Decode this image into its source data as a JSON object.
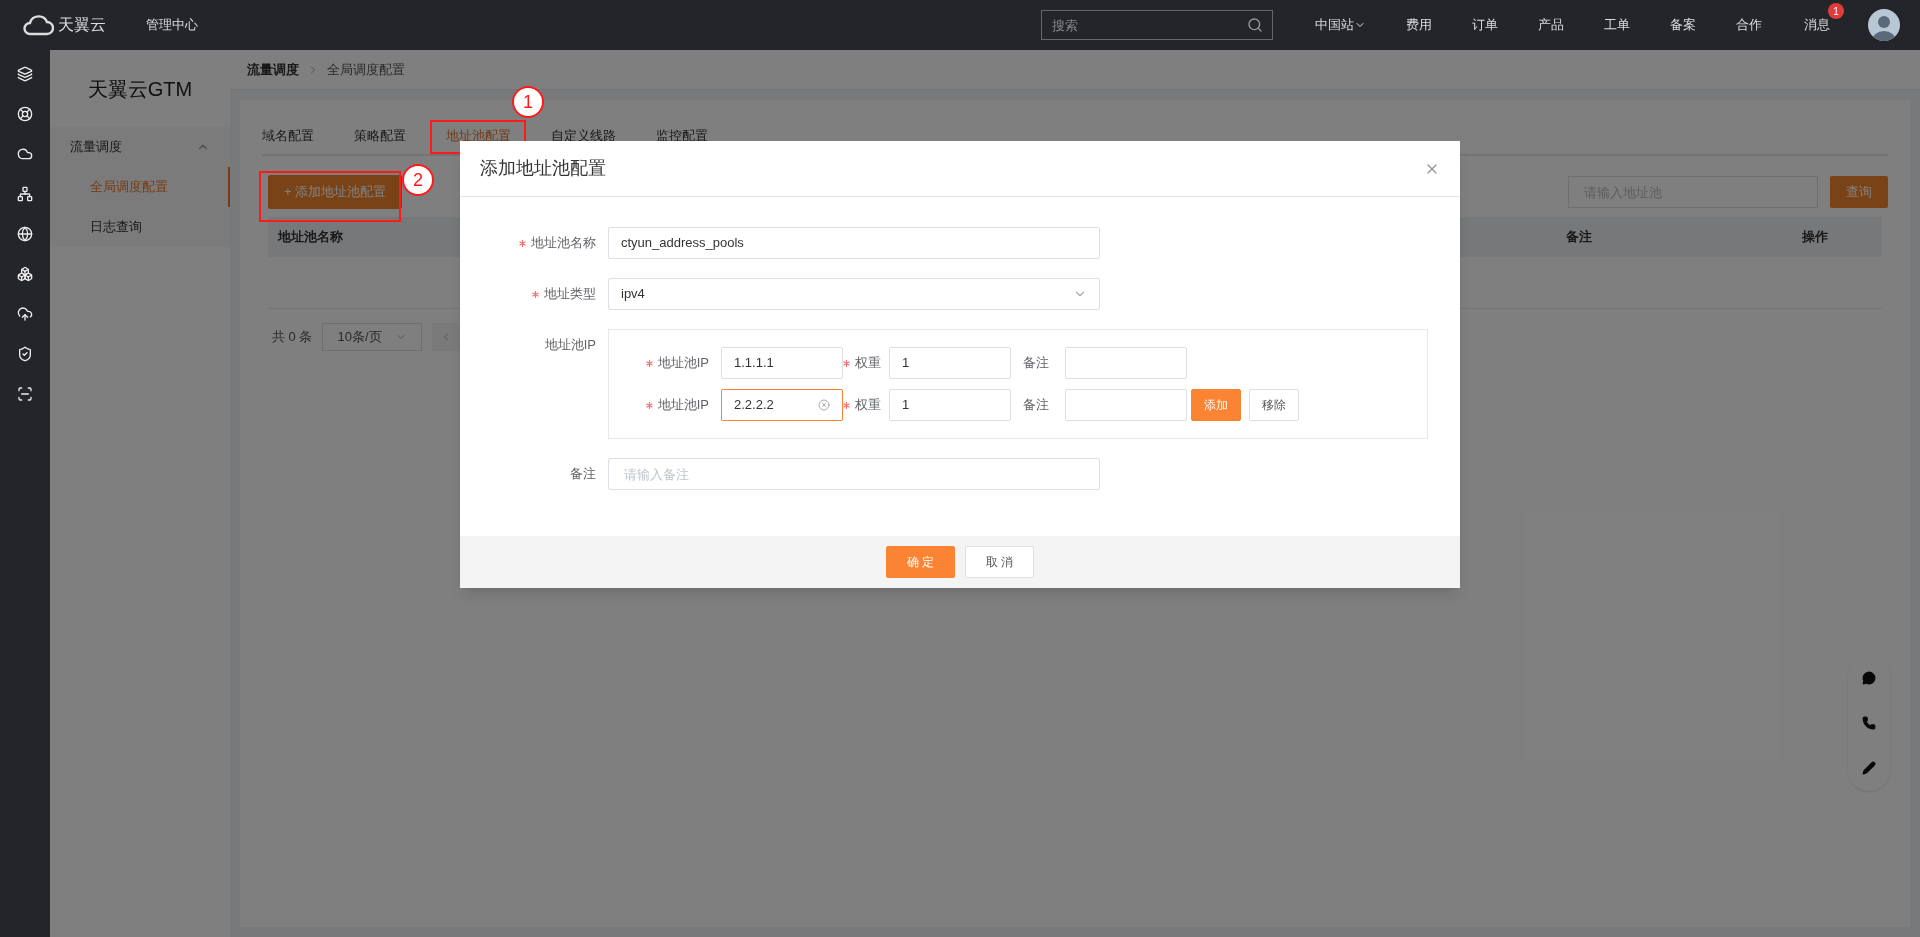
{
  "topbar": {
    "logo_text": "天翼云",
    "console": "管理中心",
    "search": {
      "placeholder": "搜索"
    },
    "region": "中国站",
    "nav": [
      "费用",
      "订单",
      "产品",
      "工单",
      "备案",
      "合作"
    ],
    "messages": {
      "label": "消息",
      "badge": "1"
    }
  },
  "product_menu": {
    "title": "天翼云GTM",
    "groups": [
      {
        "label": "流量调度",
        "expanded": true,
        "children": [
          {
            "label": "全局调度配置",
            "selected": true
          },
          {
            "label": "日志查询",
            "selected": false
          }
        ]
      }
    ]
  },
  "breadcrumb": [
    "流量调度",
    "全局调度配置"
  ],
  "tabs": [
    {
      "label": "域名配置",
      "selected": false
    },
    {
      "label": "策略配置",
      "selected": false
    },
    {
      "label": "地址池配置",
      "selected": true
    },
    {
      "label": "自定义线路",
      "selected": false
    },
    {
      "label": "监控配置",
      "selected": false
    }
  ],
  "add_button": "+ 添加地址池配置",
  "search": {
    "placeholder": "请输入地址池",
    "button": "查询"
  },
  "table": {
    "columns": [
      "地址池名称",
      "备注",
      "操作"
    ]
  },
  "pagination": {
    "total": "共 0 条",
    "page_size": "10条/页"
  },
  "modal": {
    "title": "添加地址池配置",
    "name_field": {
      "label": "地址池名称",
      "required": true,
      "value": "ctyun_address_pools"
    },
    "type_field": {
      "label": "地址类型",
      "required": true,
      "value": "ipv4"
    },
    "ip_group": {
      "label": "地址池IP",
      "rows": [
        {
          "ip_label": "地址池IP",
          "ip": "1.1.1.1",
          "focused": false,
          "weight_label": "权重",
          "weight": "1",
          "remark_label": "备注"
        },
        {
          "ip_label": "地址池IP",
          "ip": "2.2.2.2",
          "focused": true,
          "weight_label": "权重",
          "weight": "1",
          "remark_label": "备注",
          "actions": [
            {
              "label": "添加",
              "kind": "primary"
            },
            {
              "label": "移除",
              "kind": "default"
            }
          ]
        }
      ]
    },
    "remark_field": {
      "label": "备注",
      "placeholder": "请输入备注"
    },
    "buttons": [
      {
        "label": "确 定",
        "kind": "primary"
      },
      {
        "label": "取 消",
        "kind": "default"
      }
    ]
  },
  "annotations": [
    {
      "label": "1"
    },
    {
      "label": "2"
    }
  ]
}
